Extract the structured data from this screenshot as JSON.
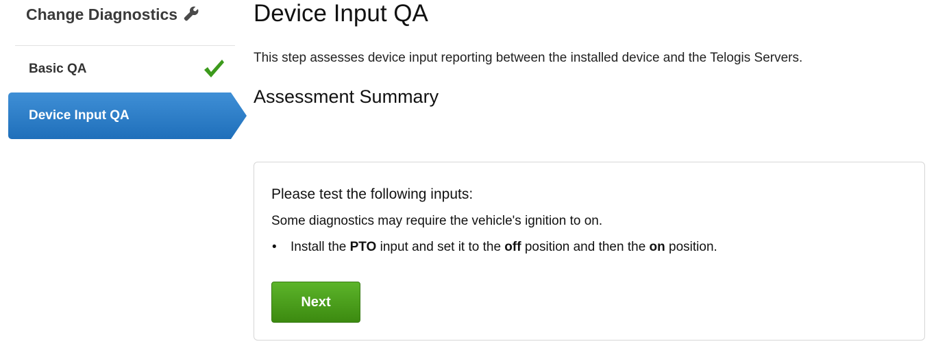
{
  "sidebar": {
    "title": "Change Diagnostics",
    "title_icon": "wrench-icon",
    "steps": [
      {
        "label": "Basic QA",
        "status": "complete",
        "icon": "checkmark-icon"
      },
      {
        "label": "Device Input QA",
        "status": "active"
      }
    ]
  },
  "main": {
    "title": "Device Input QA",
    "intro": "This step assesses device input reporting between the installed device and the Telogis Servers.",
    "summary_heading": "Assessment Summary",
    "card": {
      "heading": "Please test the following inputs:",
      "note": "Some diagnostics may require the vehicle's ignition to on.",
      "instruction": {
        "bullet": "•",
        "part1": "Install the ",
        "input_name": "PTO",
        "part2": " input and set it to the ",
        "first_position": "off",
        "part3": " position and then the ",
        "second_position": "on",
        "part4": " position."
      },
      "next_label": "Next"
    }
  },
  "colors": {
    "active_step": "#2d7fc9",
    "checkmark": "#3c9a1c",
    "next_button": "#4c9f1e"
  }
}
